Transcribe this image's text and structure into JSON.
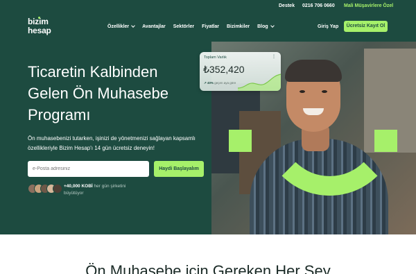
{
  "topbar": {
    "support": "Destek",
    "phone": "0216 706 0660",
    "advisor_link": "Mali Müşavirlere Özel"
  },
  "nav": {
    "logo_line1": "bizim",
    "logo_line2": "hesap",
    "items": [
      {
        "label": "Özellikler",
        "dropdown": true
      },
      {
        "label": "Avantajlar",
        "dropdown": false
      },
      {
        "label": "Sektörler",
        "dropdown": false
      },
      {
        "label": "Fiyatlar",
        "dropdown": false
      },
      {
        "label": "Bizimkiler",
        "dropdown": false
      },
      {
        "label": "Blog",
        "dropdown": true
      }
    ],
    "login": "Giriş Yap",
    "signup": "Ücretsiz Kayıt Ol"
  },
  "hero": {
    "headline": "Ticaretin Kalbinden Gelen Ön Muhasebe Programı",
    "subtext": "Ön muhasebenizi tutarken, işinizi de yönetmenizi sağlayan kapsamlı özellikleriyle Bizim Hesap'ı 14 gün ücretsiz deneyin!",
    "email_placeholder": "e-Posta adresiniz",
    "trial_button": "Haydi Başlayalım",
    "social_bold": "+40,000 KOBİ",
    "social_rest": " her gün şirketini büyütüyor"
  },
  "card": {
    "label": "Toplam Varlık",
    "menu": "⋮",
    "value": "₺352,420",
    "trend_bold": "↗ 40%",
    "trend_rest": " geçen aya göre"
  },
  "section": {
    "title": "Ön Muhasebe için Gereken Her Şey"
  },
  "colors": {
    "brand_dark": "#1d4b40",
    "accent_lime": "#a6f06a"
  }
}
